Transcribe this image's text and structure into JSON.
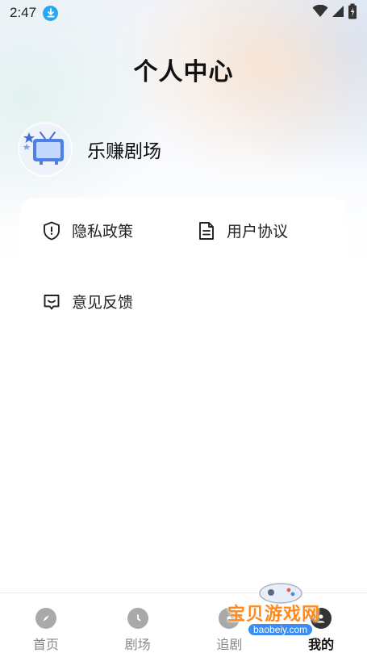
{
  "status_bar": {
    "time": "2:47"
  },
  "header": {
    "title": "个人中心"
  },
  "profile": {
    "name": "乐赚剧场",
    "avatar_icon": "tv-icon"
  },
  "menu": {
    "items": [
      {
        "label": "隐私政策",
        "icon": "shield-icon"
      },
      {
        "label": "用户协议",
        "icon": "document-icon"
      },
      {
        "label": "意见反馈",
        "icon": "feedback-icon"
      }
    ]
  },
  "tab_bar": {
    "tabs": [
      {
        "label": "首页",
        "icon": "compass-icon",
        "active": false
      },
      {
        "label": "剧场",
        "icon": "clock-icon",
        "active": false
      },
      {
        "label": "追剧",
        "icon": "follow-icon",
        "active": false
      },
      {
        "label": "我的",
        "icon": "profile-icon",
        "active": true
      }
    ]
  },
  "watermark": {
    "text": "宝贝游戏网",
    "domain": "baobeiy.com"
  },
  "colors": {
    "accent_download": "#29a8f2",
    "tab_inactive": "#a9a9a9",
    "watermark_orange": "#ff8a1a"
  }
}
